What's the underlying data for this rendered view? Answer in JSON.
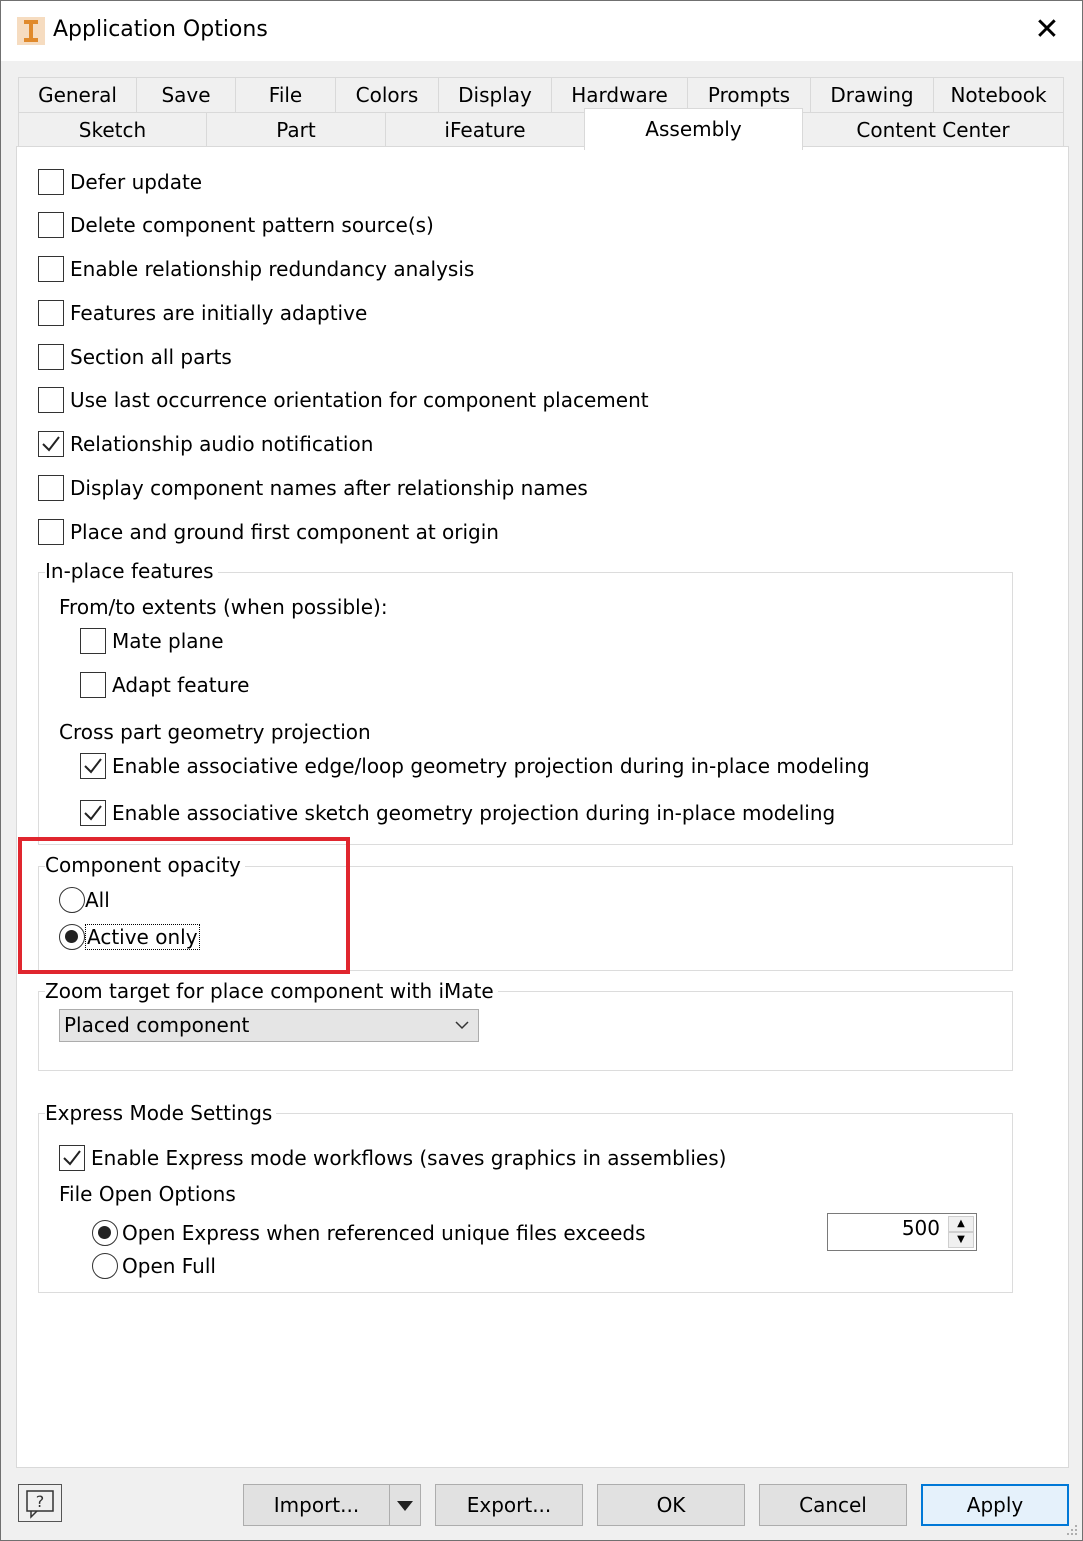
{
  "window": {
    "title": "Application Options",
    "close_glyph": "✕"
  },
  "tabs_row1": [
    "General",
    "Save",
    "File",
    "Colors",
    "Display",
    "Hardware",
    "Prompts",
    "Drawing",
    "Notebook"
  ],
  "tabs_row2": [
    "Sketch",
    "Part",
    "iFeature",
    "Assembly",
    "Content Center"
  ],
  "active_tab": "Assembly",
  "options": [
    {
      "label": "Defer update",
      "checked": false
    },
    {
      "label": "Delete component pattern source(s)",
      "checked": false
    },
    {
      "label": "Enable relationship redundancy analysis",
      "checked": false
    },
    {
      "label": "Features are initially adaptive",
      "checked": false
    },
    {
      "label": "Section all parts",
      "checked": false
    },
    {
      "label": "Use last occurrence orientation for component placement",
      "checked": false
    },
    {
      "label": "Relationship audio notification",
      "checked": true
    },
    {
      "label": "Display component names after relationship names",
      "checked": false
    },
    {
      "label": "Place and ground first component at origin",
      "checked": false
    }
  ],
  "inplace": {
    "title": "In-place features",
    "extents_label": "From/to extents (when possible):",
    "mate_plane": {
      "label": "Mate plane",
      "checked": false
    },
    "adapt_feature": {
      "label": "Adapt feature",
      "checked": false
    },
    "cross_label": "Cross part geometry projection",
    "edge_loop": {
      "label": "Enable associative edge/loop geometry projection during in-place modeling",
      "checked": true
    },
    "sketch_geom": {
      "label": "Enable associative sketch geometry projection during in-place modeling",
      "checked": true
    }
  },
  "opacity": {
    "title": "Component opacity",
    "all": {
      "label": "All",
      "selected": false
    },
    "active_only": {
      "label": "Active only",
      "selected": true
    }
  },
  "zoom": {
    "title": "Zoom target for place component with iMate",
    "selected": "Placed component"
  },
  "express": {
    "title": "Express Mode Settings",
    "enable": {
      "label": "Enable Express mode workflows (saves graphics in assemblies)",
      "checked": true
    },
    "file_open_label": "File Open Options",
    "open_express": {
      "label": "Open Express when referenced unique files exceeds",
      "selected": true
    },
    "open_full": {
      "label": "Open Full",
      "selected": false
    },
    "threshold": "500"
  },
  "buttons": {
    "import": "Import...",
    "export": "Export...",
    "ok": "OK",
    "cancel": "Cancel",
    "apply": "Apply"
  },
  "colors": {
    "highlight": "#e0262e",
    "default_button_border": "#0078d7"
  }
}
